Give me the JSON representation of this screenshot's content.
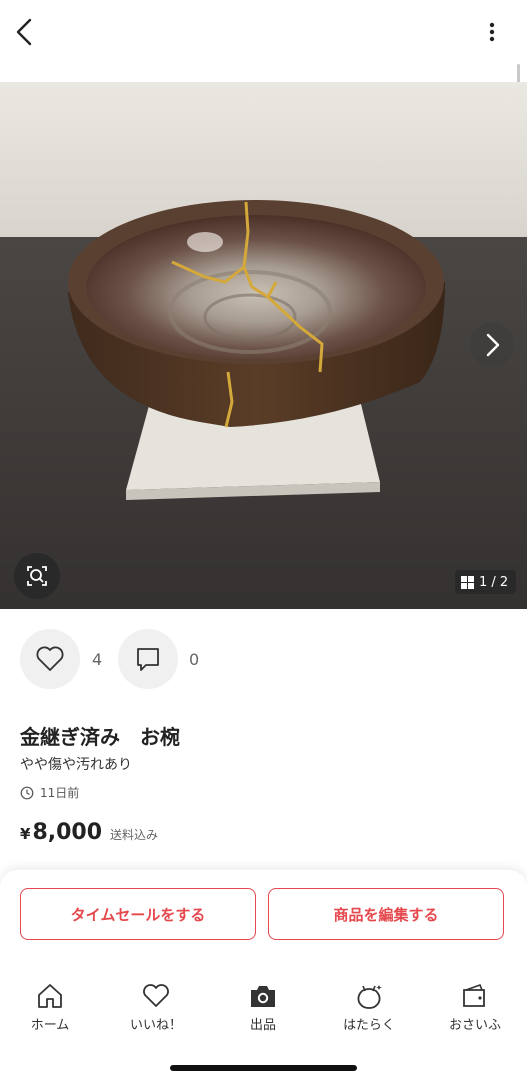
{
  "header": {
    "back_icon": "chevron-left-icon",
    "menu_icon": "more-vertical-icon"
  },
  "gallery": {
    "counter": "1 / 2",
    "current_image": 1,
    "total_images": 2
  },
  "reactions": {
    "likes": "4",
    "comments": "0"
  },
  "item": {
    "title": "金継ぎ済み　お椀",
    "condition": "やや傷や汚れあり",
    "posted": "11日前",
    "price_symbol": "¥",
    "price": "8,000",
    "shipping": "送料込み"
  },
  "actions": {
    "time_sale": "タイムセールをする",
    "edit": "商品を編集する"
  },
  "nav": [
    {
      "label": "ホーム",
      "icon": "home-icon"
    },
    {
      "label": "いいね！",
      "icon": "heart-icon"
    },
    {
      "label": "出品",
      "icon": "camera-icon"
    },
    {
      "label": "はたらく",
      "icon": "work-bag-icon"
    },
    {
      "label": "おさいふ",
      "icon": "wallet-icon"
    }
  ],
  "colors": {
    "accent": "#e5484d",
    "text": "#222222",
    "muted": "#666666"
  }
}
